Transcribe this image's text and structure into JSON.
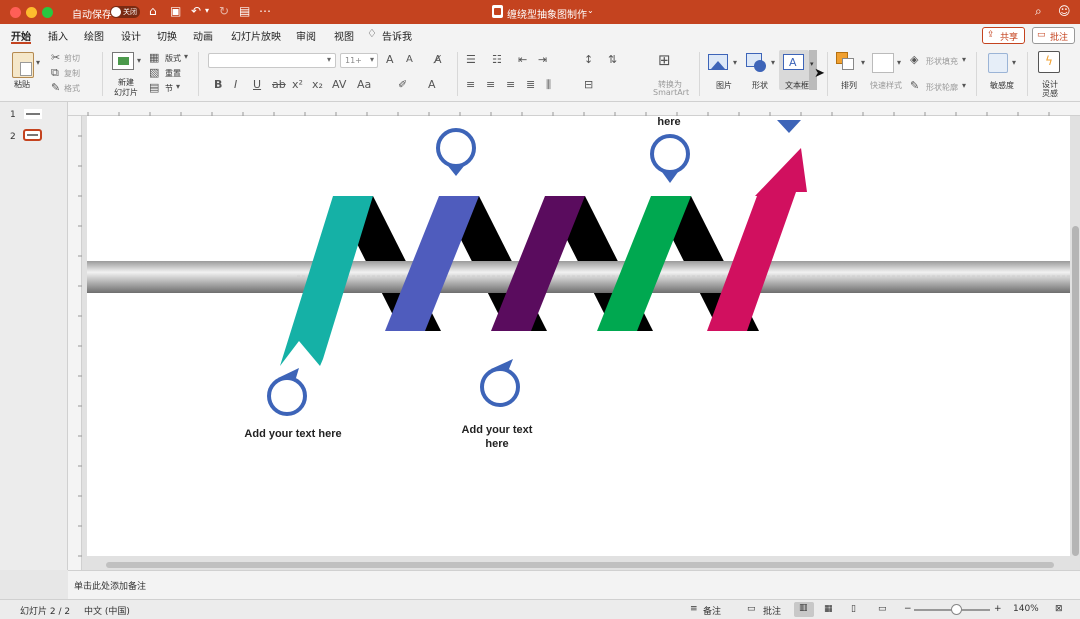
{
  "titlebar": {
    "autosave_label": "自动保存",
    "autosave_state": "关闭",
    "doc_title": "缠绕型抽象图制作",
    "colors": {
      "brand": "#c4431f"
    }
  },
  "tabs": [
    "开始",
    "插入",
    "绘图",
    "设计",
    "切换",
    "动画",
    "幻灯片放映",
    "审阅",
    "视图",
    "告诉我"
  ],
  "share_label": "共享",
  "comment_label": "批注",
  "ribbon": {
    "paste": "粘贴",
    "cut": "剪切",
    "copy": "复制",
    "format": "格式",
    "new_slide_1": "新建",
    "new_slide_2": "幻灯片",
    "layout": "版式",
    "reset": "重置",
    "section": "节",
    "font_size": "11+",
    "convert_1": "转换为",
    "convert_2": "SmartArt",
    "picture": "图片",
    "shape": "形状",
    "textbox": "文本框",
    "arrange": "排列",
    "quick_style": "快速样式",
    "shape_fill": "形状填充",
    "shape_outline": "形状轮廓",
    "sensitivity": "敏感度",
    "design_1": "设计",
    "design_2": "灵感"
  },
  "slide_panel": {
    "items": [
      "1",
      "2"
    ]
  },
  "slide": {
    "text_bottom_left": "Add your text here",
    "text_bottom_mid": "Add your text here",
    "text_top_partial": "here",
    "colors": {
      "teal": "#15b1a6",
      "blue": "#4f5cbd",
      "purple": "#5a0c5e",
      "green": "#00a850",
      "magenta": "#d1105f",
      "pin": "#3d64b8"
    }
  },
  "notes_placeholder": "单击此处添加备注",
  "status": {
    "slide_counter": "幻灯片 2 / 2",
    "language": "中文 (中国)",
    "notes": "备注",
    "comments": "批注",
    "zoom": "140%"
  }
}
